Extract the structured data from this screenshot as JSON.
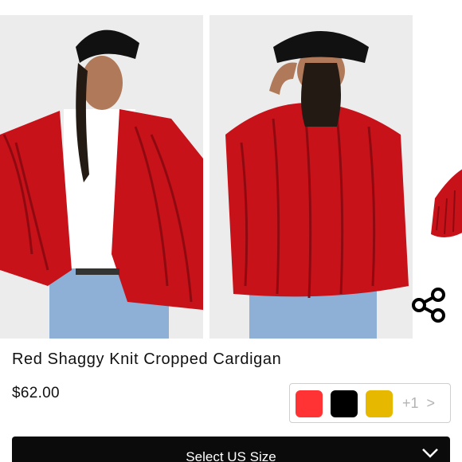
{
  "product": {
    "title": "Red Shaggy Knit Cropped Cardigan",
    "price": "$62.00"
  },
  "gallery": {
    "images": [
      {
        "alt": "model front view"
      },
      {
        "alt": "model back view"
      },
      {
        "alt": "partial next image"
      }
    ],
    "share_icon": "share-icon"
  },
  "colors": {
    "swatches": [
      "#ff3333",
      "#000000",
      "#e6b800"
    ],
    "more_label": "+1",
    "more_chevron": ">"
  },
  "size_select": {
    "label": "Select US Size",
    "icon": "chevron-down-icon"
  }
}
